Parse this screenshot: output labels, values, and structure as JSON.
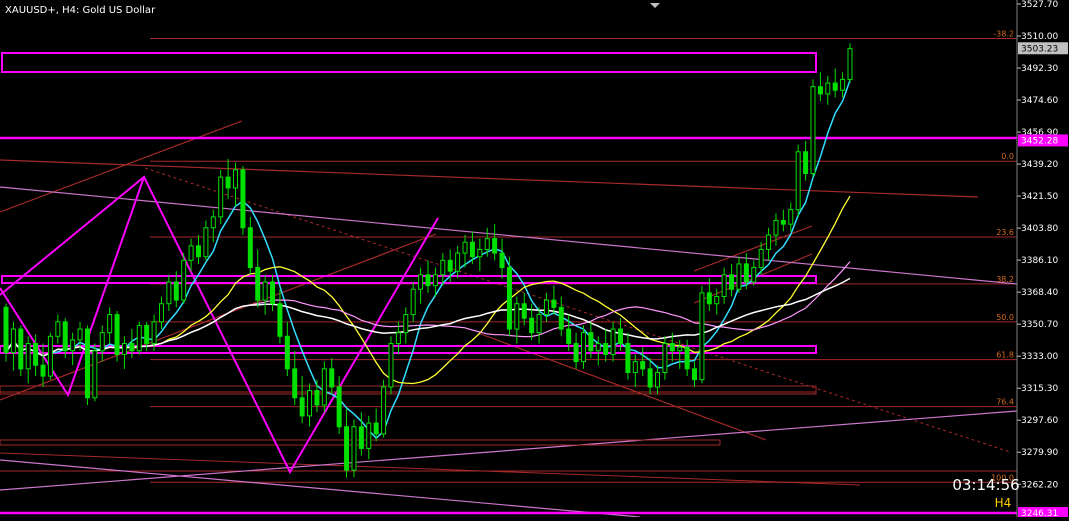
{
  "header": {
    "symbol_text": "XAUUSD+, H4:  Gold US Dollar"
  },
  "timer": {
    "countdown": "03:14:56",
    "timeframe": "H4"
  },
  "colors": {
    "background": "#000000",
    "bull_candle": "#00e000",
    "bear_candle": "#00e000",
    "magenta": "#ff00ff",
    "fib": "#a52a2a",
    "cyan": "#33ddff",
    "yellow": "#ffff33",
    "white": "#ffffff",
    "violet": "#cc66cc",
    "axis_text": "#ffffff",
    "timer_yellow": "#ffcc00"
  },
  "chart_data": {
    "type": "candlestick",
    "symbol": "XAUUSD+",
    "timeframe": "H4",
    "ylim": [
      3246.31,
      3527.7
    ],
    "y_ticks": [
      3527.7,
      3510.0,
      3492.3,
      3474.6,
      3456.9,
      3439.2,
      3421.5,
      3403.8,
      3386.1,
      3368.4,
      3350.7,
      3333.0,
      3315.3,
      3297.6,
      3279.9,
      3262.2
    ],
    "price_labels": [
      {
        "value": "3503.23",
        "price": 3503.23,
        "style": "current"
      },
      {
        "value": "3452.28",
        "price": 3452.28,
        "style": "magenta"
      },
      {
        "value": "3246.31",
        "price": 3246.31,
        "style": "magenta"
      }
    ],
    "fib_levels": [
      {
        "label": "-38.2",
        "price": 3508.6
      },
      {
        "label": "0.0",
        "price": 3440.8
      },
      {
        "label": "23.6",
        "price": 3398.9
      },
      {
        "label": "38.2",
        "price": 3373.0
      },
      {
        "label": "50.0",
        "price": 3352.0
      },
      {
        "label": "61.8",
        "price": 3331.1
      },
      {
        "label": "76.4",
        "price": 3305.1
      },
      {
        "label": "100.0",
        "price": 3263.3
      }
    ],
    "candles": [
      [
        3360,
        3362,
        3330,
        3335
      ],
      [
        3335,
        3352,
        3325,
        3348
      ],
      [
        3348,
        3350,
        3322,
        3326
      ],
      [
        3326,
        3344,
        3318,
        3340
      ],
      [
        3340,
        3345,
        3322,
        3328
      ],
      [
        3328,
        3340,
        3316,
        3322
      ],
      [
        3322,
        3346,
        3320,
        3344
      ],
      [
        3344,
        3356,
        3340,
        3352
      ],
      [
        3352,
        3354,
        3332,
        3336
      ],
      [
        3336,
        3346,
        3328,
        3342
      ],
      [
        3342,
        3352,
        3336,
        3348
      ],
      [
        3348,
        3350,
        3306,
        3310
      ],
      [
        3310,
        3340,
        3308,
        3336
      ],
      [
        3336,
        3350,
        3330,
        3346
      ],
      [
        3346,
        3360,
        3340,
        3356
      ],
      [
        3356,
        3358,
        3330,
        3334
      ],
      [
        3334,
        3344,
        3326,
        3340
      ],
      [
        3340,
        3348,
        3332,
        3336
      ],
      [
        3336,
        3352,
        3334,
        3350
      ],
      [
        3350,
        3352,
        3336,
        3340
      ],
      [
        3340,
        3356,
        3336,
        3352
      ],
      [
        3352,
        3366,
        3348,
        3362
      ],
      [
        3362,
        3378,
        3358,
        3374
      ],
      [
        3374,
        3380,
        3360,
        3364
      ],
      [
        3364,
        3390,
        3362,
        3386
      ],
      [
        3386,
        3398,
        3380,
        3394
      ],
      [
        3394,
        3400,
        3384,
        3388
      ],
      [
        3388,
        3408,
        3386,
        3404
      ],
      [
        3404,
        3414,
        3396,
        3410
      ],
      [
        3410,
        3436,
        3406,
        3432
      ],
      [
        3432,
        3442,
        3420,
        3426
      ],
      [
        3426,
        3440,
        3416,
        3436
      ],
      [
        3436,
        3438,
        3400,
        3404
      ],
      [
        3404,
        3410,
        3378,
        3382
      ],
      [
        3382,
        3392,
        3360,
        3364
      ],
      [
        3364,
        3378,
        3356,
        3374
      ],
      [
        3374,
        3378,
        3358,
        3362
      ],
      [
        3362,
        3370,
        3340,
        3344
      ],
      [
        3344,
        3352,
        3322,
        3326
      ],
      [
        3326,
        3336,
        3306,
        3310
      ],
      [
        3310,
        3322,
        3296,
        3300
      ],
      [
        3300,
        3318,
        3294,
        3314
      ],
      [
        3314,
        3320,
        3302,
        3306
      ],
      [
        3306,
        3330,
        3302,
        3326
      ],
      [
        3326,
        3332,
        3312,
        3316
      ],
      [
        3316,
        3322,
        3290,
        3294
      ],
      [
        3294,
        3304,
        3266,
        3270
      ],
      [
        3270,
        3298,
        3266,
        3294
      ],
      [
        3294,
        3302,
        3278,
        3282
      ],
      [
        3282,
        3300,
        3276,
        3296
      ],
      [
        3296,
        3304,
        3286,
        3290
      ],
      [
        3290,
        3320,
        3288,
        3316
      ],
      [
        3316,
        3344,
        3312,
        3340
      ],
      [
        3340,
        3352,
        3334,
        3346
      ],
      [
        3346,
        3360,
        3340,
        3356
      ],
      [
        3356,
        3374,
        3352,
        3370
      ],
      [
        3370,
        3382,
        3362,
        3378
      ],
      [
        3378,
        3386,
        3368,
        3372
      ],
      [
        3372,
        3382,
        3366,
        3378
      ],
      [
        3378,
        3390,
        3372,
        3386
      ],
      [
        3386,
        3392,
        3374,
        3380
      ],
      [
        3380,
        3394,
        3376,
        3390
      ],
      [
        3390,
        3400,
        3382,
        3396
      ],
      [
        3396,
        3402,
        3384,
        3388
      ],
      [
        3388,
        3398,
        3380,
        3392
      ],
      [
        3392,
        3404,
        3388,
        3398
      ],
      [
        3398,
        3406,
        3386,
        3390
      ],
      [
        3390,
        3398,
        3376,
        3382
      ],
      [
        3382,
        3388,
        3344,
        3348
      ],
      [
        3348,
        3366,
        3340,
        3362
      ],
      [
        3362,
        3368,
        3350,
        3354
      ],
      [
        3354,
        3362,
        3342,
        3346
      ],
      [
        3346,
        3360,
        3340,
        3356
      ],
      [
        3356,
        3368,
        3352,
        3364
      ],
      [
        3364,
        3372,
        3356,
        3360
      ],
      [
        3360,
        3366,
        3344,
        3348
      ],
      [
        3348,
        3356,
        3336,
        3340
      ],
      [
        3340,
        3346,
        3326,
        3330
      ],
      [
        3330,
        3350,
        3326,
        3346
      ],
      [
        3346,
        3352,
        3332,
        3336
      ],
      [
        3336,
        3344,
        3328,
        3340
      ],
      [
        3340,
        3348,
        3330,
        3334
      ],
      [
        3334,
        3352,
        3330,
        3348
      ],
      [
        3348,
        3354,
        3336,
        3340
      ],
      [
        3340,
        3346,
        3320,
        3324
      ],
      [
        3324,
        3334,
        3316,
        3330
      ],
      [
        3330,
        3338,
        3322,
        3326
      ],
      [
        3326,
        3332,
        3312,
        3316
      ],
      [
        3316,
        3328,
        3312,
        3324
      ],
      [
        3324,
        3344,
        3320,
        3340
      ],
      [
        3340,
        3346,
        3330,
        3336
      ],
      [
        3336,
        3342,
        3326,
        3338
      ],
      [
        3338,
        3342,
        3322,
        3326
      ],
      [
        3326,
        3330,
        3316,
        3320
      ],
      [
        3320,
        3372,
        3318,
        3368
      ],
      [
        3368,
        3376,
        3358,
        3362
      ],
      [
        3362,
        3370,
        3356,
        3366
      ],
      [
        3366,
        3382,
        3362,
        3378
      ],
      [
        3378,
        3384,
        3366,
        3370
      ],
      [
        3370,
        3388,
        3368,
        3384
      ],
      [
        3384,
        3390,
        3370,
        3374
      ],
      [
        3374,
        3386,
        3372,
        3382
      ],
      [
        3382,
        3396,
        3378,
        3392
      ],
      [
        3392,
        3404,
        3386,
        3400
      ],
      [
        3400,
        3412,
        3394,
        3408
      ],
      [
        3408,
        3414,
        3402,
        3406
      ],
      [
        3406,
        3418,
        3402,
        3414
      ],
      [
        3414,
        3450,
        3410,
        3446
      ],
      [
        3446,
        3452,
        3430,
        3434
      ],
      [
        3434,
        3486,
        3432,
        3482
      ],
      [
        3482,
        3490,
        3474,
        3478
      ],
      [
        3478,
        3488,
        3472,
        3484
      ],
      [
        3484,
        3492,
        3476,
        3480
      ],
      [
        3480,
        3490,
        3476,
        3486
      ],
      [
        3486,
        3506,
        3484,
        3503
      ]
    ]
  }
}
